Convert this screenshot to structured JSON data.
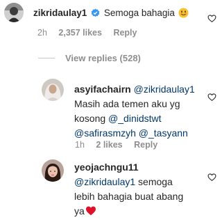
{
  "comments": [
    {
      "username": "zikridaulay1",
      "verified": true,
      "text": "Semoga bahagia",
      "emoji": "smiling-face-emoji",
      "time": "2h",
      "likes": "2,357 likes",
      "reply": "Reply"
    }
  ],
  "view_replies": "View replies (528)",
  "replies": [
    {
      "username": "asyifachairn",
      "mention": "@zikridaulay1",
      "line1": "Masih ada temen aku yg",
      "line2_text": "kosong ",
      "line2_mention": "@_dinidstwt",
      "line3_mention_a": "@safirasmzyh",
      "line3_mention_b": "@_tasyann",
      "time": "1h",
      "likes": "2 likes",
      "reply": "Reply"
    },
    {
      "username": "yeojachngu11",
      "mention": "@zikridaulay1",
      "text_a": " semoga",
      "line2": "lebih bahagia buat abang",
      "line3": "ya",
      "emoji": "red-heart-emoji"
    }
  ],
  "icons": {
    "like": "heart-outline-icon",
    "verified": "verified-badge-icon"
  },
  "colors": {
    "text": "#262626",
    "secondary": "#8e8e8e",
    "mention": "#00376b",
    "verified": "#3897f0",
    "emoji_heart": "#e0102a",
    "emoji_face": "#f6c22e"
  }
}
